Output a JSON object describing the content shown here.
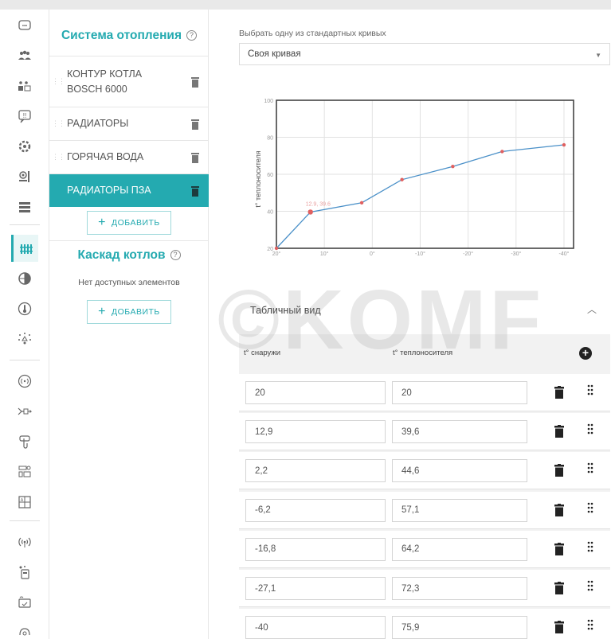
{
  "watermark": "©KOMF",
  "sidebar": {
    "icons": [
      "log-icon",
      "users-icon",
      "groups-icon",
      "messages-icon",
      "engine-icon",
      "settings-icon",
      "list-icon",
      "heating-icon",
      "globe-icon",
      "thermometer-icon",
      "sensor-icon",
      "signal-icon",
      "relay-icon",
      "touch-icon",
      "control-icon",
      "schedule-icon",
      "wireless-icon",
      "switch-icon",
      "rules-icon",
      "script-icon"
    ]
  },
  "heating": {
    "title": "Система отопления",
    "items": [
      {
        "label_line1": "КОНТУР КОТЛА",
        "label_line2": "BOSCH 6000"
      },
      {
        "label_line1": "РАДИАТОРЫ",
        "label_line2": ""
      },
      {
        "label_line1": "ГОРЯЧАЯ ВОДА",
        "label_line2": ""
      },
      {
        "label_line1": "РАДИАТОРЫ ПЗА",
        "label_line2": ""
      }
    ],
    "add_label": "ДОБАВИТЬ"
  },
  "cascade": {
    "title": "Каскад котлов",
    "empty": "Нет доступных элементов",
    "add_label": "ДОБАВИТЬ"
  },
  "curve": {
    "select_label": "Выбрать одну из стандартных кривых",
    "selected": "Своя кривая"
  },
  "chart_data": {
    "type": "line",
    "ylabel": "t° теплоносителя",
    "xlabel": "",
    "x_ticks": [
      "20°",
      "10°",
      "0°",
      "-10°",
      "-20°",
      "-30°",
      "-40°"
    ],
    "y_ticks": [
      "20",
      "40",
      "60",
      "80",
      "100"
    ],
    "xlim": [
      20,
      -42
    ],
    "ylim": [
      20,
      100
    ],
    "series": [
      {
        "x": [
          20,
          12.9,
          2.2,
          -6.2,
          -16.8,
          -27.1,
          -40
        ],
        "y": [
          20,
          39.6,
          44.6,
          57.1,
          64.2,
          72.3,
          75.9
        ]
      }
    ],
    "highlight_label": "12.9, 39.6",
    "line_color": "#4a90c8",
    "point_color": "#e06060",
    "grid": true
  },
  "table": {
    "title": "Табличный вид",
    "col_outside": "t° снаружи",
    "col_carrier": "t° теплоносителя",
    "rows": [
      {
        "outside": "20",
        "carrier": "20"
      },
      {
        "outside": "12,9",
        "carrier": "39,6"
      },
      {
        "outside": "2,2",
        "carrier": "44,6"
      },
      {
        "outside": "-6,2",
        "carrier": "57,1"
      },
      {
        "outside": "-16,8",
        "carrier": "64,2"
      },
      {
        "outside": "-27,1",
        "carrier": "72,3"
      },
      {
        "outside": "-40",
        "carrier": "75,9"
      }
    ]
  },
  "colors": {
    "accent": "#24aab0"
  }
}
